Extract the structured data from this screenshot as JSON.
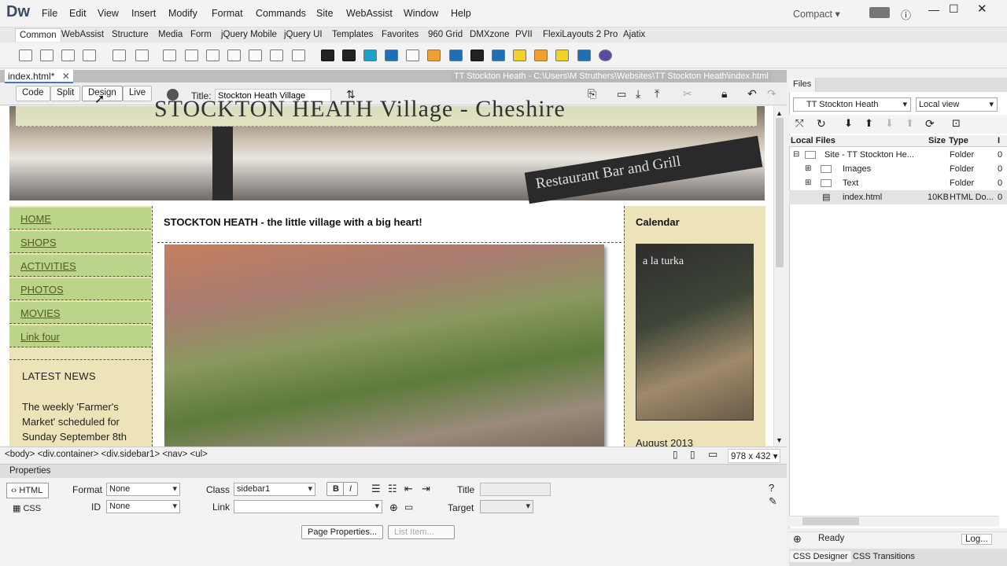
{
  "app": {
    "logo": "Dw",
    "menus": [
      "File",
      "Edit",
      "View",
      "Insert",
      "Modify",
      "Format",
      "Commands",
      "Site",
      "WebAssist",
      "Window",
      "Help"
    ],
    "workspace": "Compact"
  },
  "insert_tabs": [
    "Common",
    "WebAssist",
    "Structure",
    "Media",
    "Form",
    "jQuery Mobile",
    "jQuery UI",
    "Templates",
    "Favorites",
    "960 Grid",
    "DMXzone",
    "PVII",
    "FlexiLayouts 2 Pro",
    "Ajatix"
  ],
  "document": {
    "tab_name": "index.html*",
    "path": "TT Stockton Heath - C:\\Users\\M Struthers\\Websites\\TT Stockton Heath\\index.html",
    "view_buttons": [
      "Code",
      "Split",
      "Design",
      "Live"
    ],
    "title_label": "Title:",
    "title_value": "Stockton Heath Village"
  },
  "page": {
    "header_text": "STOCKTON HEATH Village - Cheshire",
    "sign_text": "Restaurant Bar and Grill",
    "nav_links": [
      "HOME",
      "SHOPS",
      "ACTIVITIES",
      "PHOTOS",
      "MOVIES",
      "Link four"
    ],
    "latest_news_heading": "LATEST NEWS",
    "news_text": "The weekly 'Farmer's Market' scheduled for Sunday September 8th",
    "content_heading": "STOCKTON HEATH - the little village with a big heart!",
    "sidebar_heading": "Calendar",
    "sidebar_date": "August 2013",
    "side_photo_text": "a la turka"
  },
  "status": {
    "tag_path": "<body> <div.container> <div.sidebar1> <nav> <ul>",
    "view_size": "978 x 432"
  },
  "properties": {
    "panel_title": "Properties",
    "html_label": "HTML",
    "css_label": "CSS",
    "format_label": "Format",
    "format_value": "None",
    "id_label": "ID",
    "id_value": "None",
    "class_label": "Class",
    "class_value": "sidebar1",
    "link_label": "Link",
    "link_value": "",
    "title_label": "Title",
    "target_label": "Target",
    "page_properties_button": "Page Properties...",
    "list_item_button": "List Item...",
    "bold": "B",
    "italic": "I"
  },
  "files": {
    "panel_title": "Files",
    "site": "TT Stockton Heath",
    "view": "Local view",
    "columns": [
      "Local Files",
      "Size",
      "Type",
      "I"
    ],
    "rows": [
      {
        "name": "Site - TT Stockton He...",
        "size": "",
        "type": "Folder",
        "mod": "0"
      },
      {
        "name": "Images",
        "size": "",
        "type": "Folder",
        "mod": "0"
      },
      {
        "name": "Text",
        "size": "",
        "type": "Folder",
        "mod": "0"
      },
      {
        "name": "index.html",
        "size": "10KB",
        "type": "HTML Do...",
        "mod": "0"
      }
    ],
    "status": "Ready",
    "log_button": "Log...",
    "bottom_tabs": [
      "CSS Designer",
      "CSS Transitions"
    ]
  }
}
